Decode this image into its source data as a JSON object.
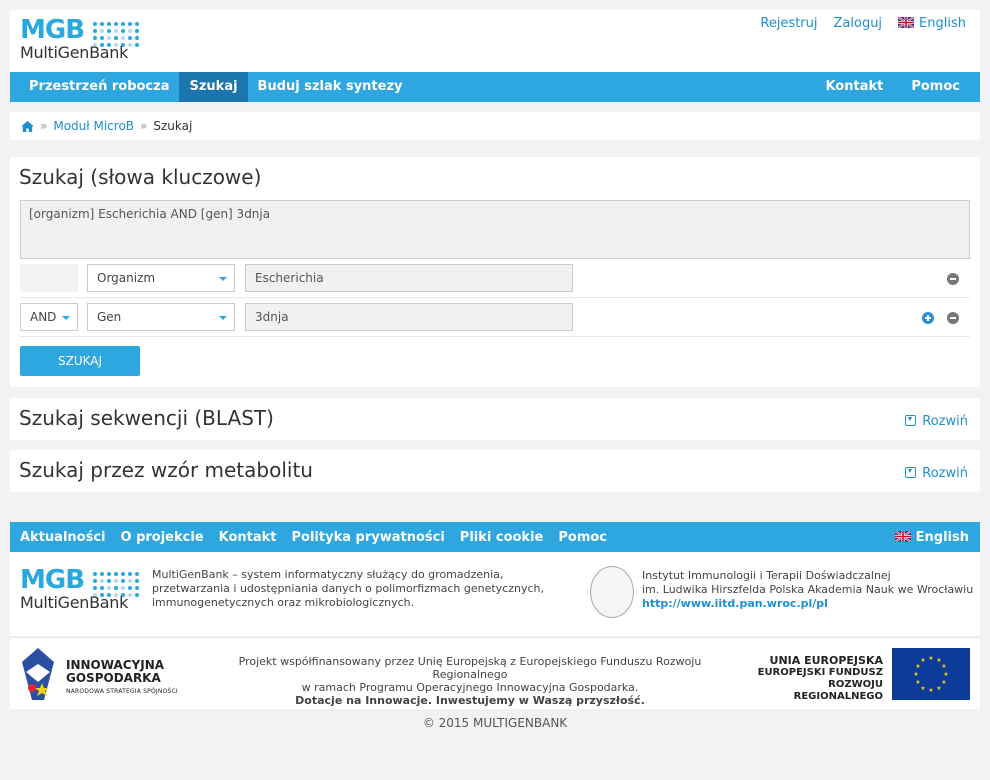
{
  "header": {
    "logo_abbr": "MGB",
    "logo_name": "MultiGenBank",
    "links": [
      "Rejestruj",
      "Zaloguj"
    ],
    "language": "English"
  },
  "nav": {
    "left": [
      "Przestrzeń robocza",
      "Szukaj",
      "Buduj szlak syntezy"
    ],
    "active": "Szukaj",
    "right": [
      "Kontakt",
      "Pomoc"
    ]
  },
  "breadcrumb": [
    "Moduł MicroB",
    "Szukaj"
  ],
  "search": {
    "title": "Szukaj (słowa kluczowe)",
    "query": "[organizm] Escherichia AND [gen] 3dnja",
    "rows": [
      {
        "operator": "",
        "field": "Organizm",
        "value": "Escherichia"
      },
      {
        "operator": "AND",
        "field": "Gen",
        "value": "3dnja"
      }
    ],
    "button": "SZUKAJ"
  },
  "panels": [
    {
      "title": "Szukaj sekwencji (BLAST)",
      "expand": "Rozwiń"
    },
    {
      "title": "Szukaj przez wzór metabolitu",
      "expand": "Rozwiń"
    }
  ],
  "footer": {
    "nav": [
      "Aktualności",
      "O projekcie",
      "Kontakt",
      "Polityka prywatności",
      "Pliki cookie",
      "Pomoc"
    ],
    "language": "English",
    "description": "MultiGenBank – system informatyczny służący do gromadzenia, przetwarzania i udostępniania danych o polimorfizmach genetycznych, immunogenetycznych oraz mikrobiologicznych.",
    "institute_line1": "Instytut Immunologii i Terapii Doświadczalnej",
    "institute_line2": "im. Ludwika Hirszfelda Polska Akademia Nauk we Wrocławiu",
    "institute_url": "http://www.iitd.pan.wroc.pl/pl",
    "ig_line1": "INNOWACYJNA",
    "ig_line2": "GOSPODARKA",
    "ig_line3": "NARODOWA STRATEGIA SPÓJNOŚCI",
    "project_line1": "Projekt współfinansowany przez Unię Europejską z Europejskiego Funduszu Rozwoju Regionalnego",
    "project_line2": "w ramach Programu Operacyjnego Innowacyjna Gospodarka.",
    "project_line3": "Dotacje na Innowacje. Inwestujemy w Waszą przyszłość.",
    "ue_line1": "UNIA EUROPEJSKA",
    "ue_line2": "EUROPEJSKI FUNDUSZ",
    "ue_line3": "ROZWOJU REGIONALNEGO",
    "copyright": "© 2015 MULTIGENBANK"
  }
}
